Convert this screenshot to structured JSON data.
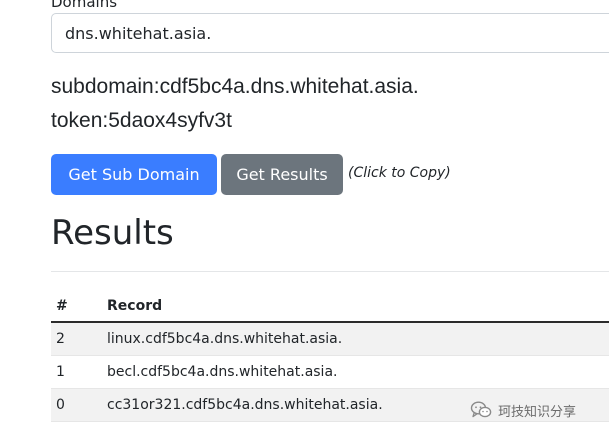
{
  "form": {
    "domains_label": "Domains",
    "domain_value": "dns.whitehat.asia."
  },
  "info": {
    "subdomain": "subdomain:cdf5bc4a.dns.whitehat.asia.",
    "token": "token:5daox4syfv3t"
  },
  "actions": {
    "get_sub_domain_label": "Get Sub Domain",
    "get_results_label": "Get Results",
    "copy_hint": "(Click to Copy)"
  },
  "results": {
    "heading": "Results",
    "columns": [
      "#",
      "Record"
    ],
    "rows": [
      {
        "num": "2",
        "record": "linux.cdf5bc4a.dns.whitehat.asia."
      },
      {
        "num": "1",
        "record": "becl.cdf5bc4a.dns.whitehat.asia."
      },
      {
        "num": "0",
        "record": "cc31or321.cdf5bc4a.dns.whitehat.asia."
      }
    ]
  },
  "watermark": {
    "text": "珂技知识分享",
    "icon": "wechat-icon"
  },
  "colors": {
    "primary": "#3a7dff",
    "secondary": "#6c757d",
    "row_stripe": "#f2f2f2"
  }
}
